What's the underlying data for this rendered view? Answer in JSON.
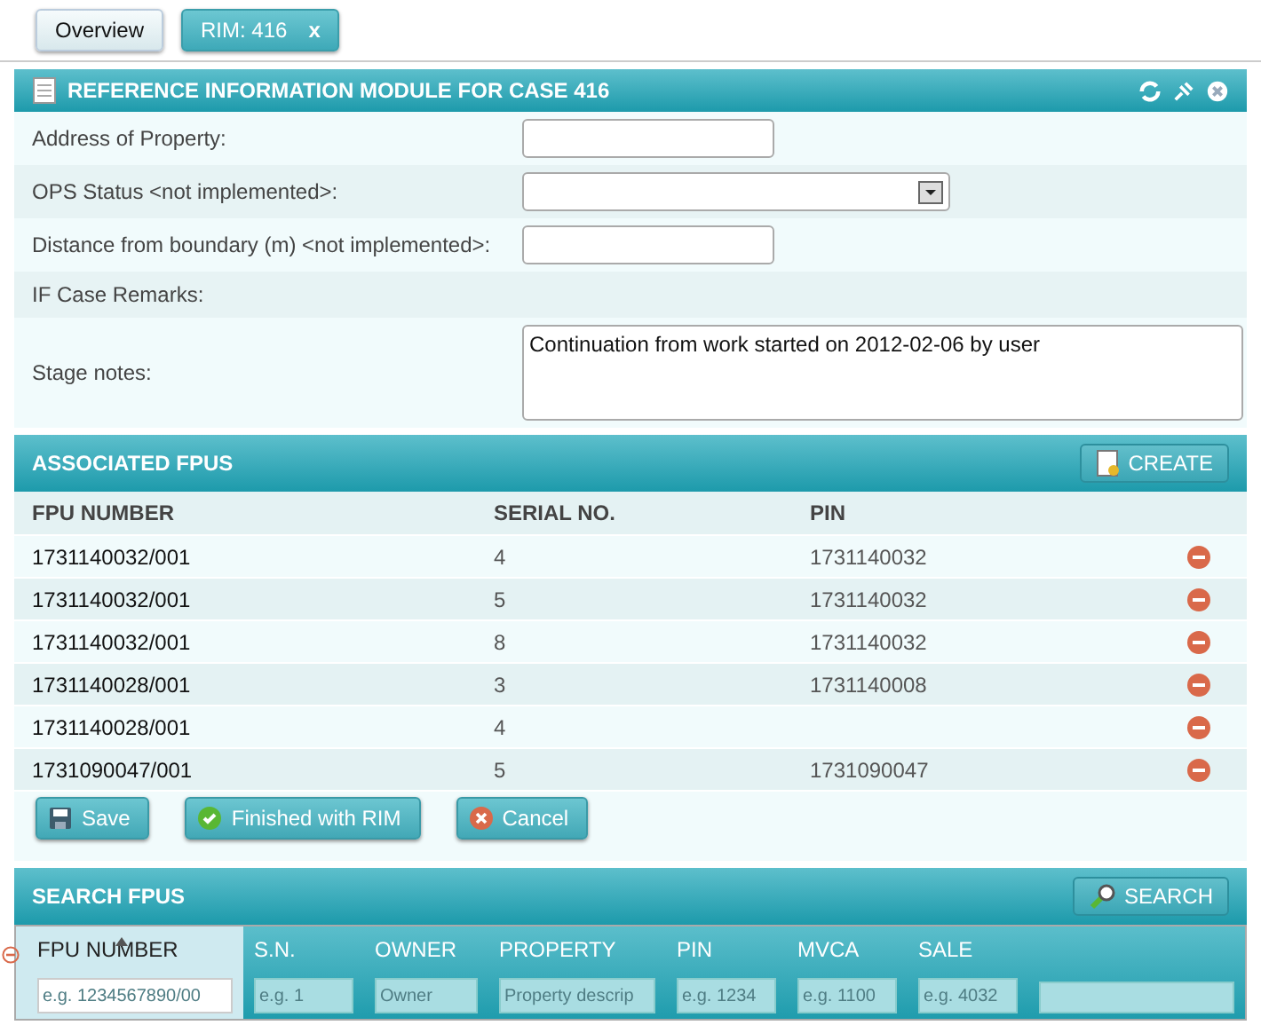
{
  "tabs": [
    {
      "label": "Overview",
      "selected": false
    },
    {
      "label": "RIM: 416",
      "selected": true,
      "close_label": "x"
    }
  ],
  "rim_panel": {
    "title": "REFERENCE INFORMATION MODULE FOR CASE 416",
    "fields": [
      {
        "label": "Address of Property:",
        "kind": "text"
      },
      {
        "label": "OPS Status <not implemented>:",
        "kind": "select"
      },
      {
        "label": "Distance from boundary (m) <not implemented>:",
        "kind": "text"
      },
      {
        "label": "IF Case Remarks:",
        "kind": "none"
      },
      {
        "label": "Stage notes:",
        "kind": "textarea",
        "value": "Continuation from work started on 2012-02-06 by user"
      }
    ]
  },
  "associated_fpus": {
    "title": "ASSOCIATED FPUS",
    "create_button": "CREATE",
    "columns": [
      "FPU NUMBER",
      "SERIAL NO.",
      "PIN"
    ],
    "rows": [
      {
        "fpu_number": "1731140032/001",
        "serial_no": "4",
        "pin": "1731140032"
      },
      {
        "fpu_number": "1731140032/001",
        "serial_no": "5",
        "pin": "1731140032"
      },
      {
        "fpu_number": "1731140032/001",
        "serial_no": "8",
        "pin": "1731140032"
      },
      {
        "fpu_number": "1731140028/001",
        "serial_no": "3",
        "pin": "1731140008"
      },
      {
        "fpu_number": "1731140028/001",
        "serial_no": "4"
      },
      {
        "fpu_number": "1731090047/001",
        "serial_no": "5",
        "pin": "1731090047"
      }
    ],
    "buttons": [
      {
        "label": "Save",
        "kind": "save"
      },
      {
        "label": "Finished with RIM",
        "kind": "finish"
      },
      {
        "label": "Cancel",
        "kind": "cancel"
      }
    ]
  },
  "search_fpus": {
    "title": "SEARCH FPUS",
    "search_button": "SEARCH",
    "filters": [
      {
        "label": "FPU NUMBER",
        "placeholder": "e.g. 1234567890/00",
        "selected": true
      },
      {
        "label": "S.N.",
        "placeholder": "e.g. 1",
        "selected": false
      },
      {
        "label": "OWNER",
        "placeholder": "Owner",
        "selected": false
      },
      {
        "label": "PROPERTY",
        "placeholder": "Property descrip",
        "selected": false
      },
      {
        "label": "PIN",
        "placeholder": "e.g. 1234",
        "selected": false
      },
      {
        "label": "MVCA",
        "placeholder": "e.g. 1100",
        "selected": false
      },
      {
        "label": "SALE",
        "placeholder": "e.g. 4032",
        "selected": false
      }
    ]
  }
}
